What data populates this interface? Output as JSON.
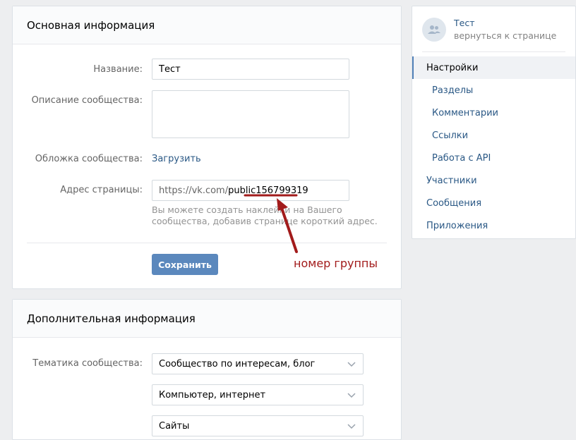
{
  "basic": {
    "title": "Основная информация",
    "name_label": "Название:",
    "name_value": "Тест",
    "desc_label": "Описание сообщества:",
    "desc_value": "",
    "cover_label": "Обложка сообщества:",
    "cover_link": "Загрузить",
    "address_label": "Адрес страницы:",
    "address_prefix": "https://vk.com/",
    "address_value_a": "public",
    "address_value_b": "156799319",
    "address_hint": "Вы можете создать наклейки на Вашего сообщества, добавив странице короткий адрес.",
    "save_label": "Сохранить"
  },
  "annotation": {
    "text": "номер группы",
    "color": "#a21b1b"
  },
  "extra": {
    "title": "Дополнительная информация",
    "topic_label": "Тематика сообщества:",
    "topic_1": "Сообщество по интересам, блог",
    "topic_2": "Компьютер, интернет",
    "topic_3": "Сайты"
  },
  "sidebar": {
    "group_name": "Тест",
    "back_label": "вернуться к странице",
    "items": [
      {
        "label": "Настройки",
        "active": true
      },
      {
        "label": "Разделы"
      },
      {
        "label": "Комментарии"
      },
      {
        "label": "Ссылки"
      },
      {
        "label": "Работа с API"
      },
      {
        "label": "Участники"
      },
      {
        "label": "Сообщения"
      },
      {
        "label": "Приложения"
      }
    ]
  },
  "colors": {
    "background": "#edeef0",
    "link": "#2a5885",
    "button": "#5b88bd",
    "active_accent": "#5181b8"
  }
}
